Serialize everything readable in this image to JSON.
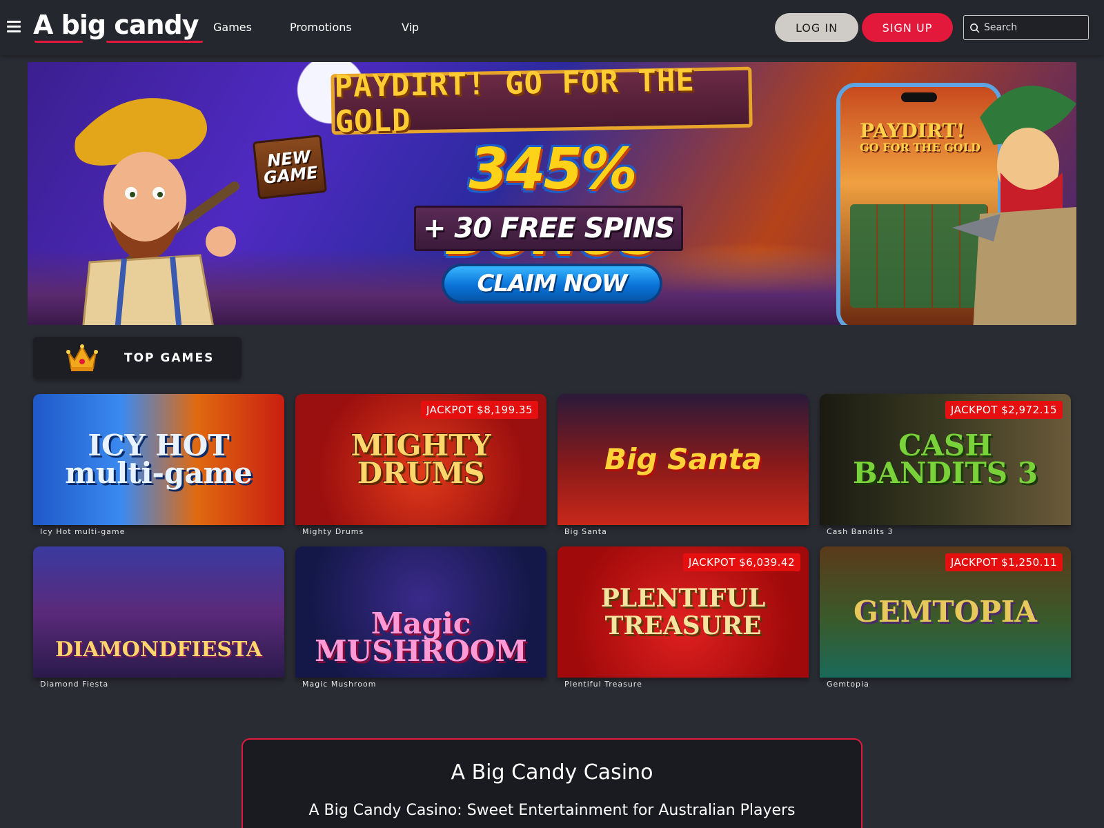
{
  "header": {
    "logo": "A big candy",
    "nav": [
      "Games",
      "Promotions",
      "Vip"
    ],
    "login_label": "LOG IN",
    "signup_label": "SIGN UP",
    "search_placeholder": "Search"
  },
  "banner": {
    "title": "PAYDIRT! GO FOR THE GOLD",
    "new_game_line1": "NEW",
    "new_game_line2": "GAME",
    "bonus": "345% BONUS",
    "spins": "+ 30 FREE SPINS",
    "cta": "CLAIM NOW",
    "phone_title_line1": "PAYDIRT!",
    "phone_title_line2": "GO FOR THE GOLD"
  },
  "top_games": {
    "title": "TOP GAMES",
    "games": [
      {
        "name": "Icy Hot multi-game",
        "logo": "ICY HOT multi-game",
        "jackpot": ""
      },
      {
        "name": "Mighty Drums",
        "logo": "MIGHTY DRUMS",
        "jackpot": "JACKPOT $8,199.35"
      },
      {
        "name": "Big Santa",
        "logo": "Big Santa",
        "jackpot": ""
      },
      {
        "name": "Cash Bandits 3",
        "logo": "CASH BANDITS 3",
        "jackpot": "JACKPOT $2,972.15"
      },
      {
        "name": "Diamond Fiesta",
        "logo": "DIAMONDFIESTA",
        "jackpot": ""
      },
      {
        "name": "Magic Mushroom",
        "logo": "Magic MUSHROOM",
        "jackpot": ""
      },
      {
        "name": "Plentiful Treasure",
        "logo": "PLENTIFUL TREASURE",
        "jackpot": "JACKPOT $6,039.42"
      },
      {
        "name": "Gemtopia",
        "logo": "GEMTOPIA",
        "jackpot": "JACKPOT $1,250.11"
      }
    ]
  },
  "info": {
    "title": "A Big Candy Casino",
    "subtitle": "A Big Candy Casino: Sweet Entertainment for Australian Players"
  },
  "colors": {
    "background": "#2a2c33",
    "header": "#25272e",
    "accent_red": "#e3193c",
    "login_bg": "#cfcbc6",
    "jackpot_red": "#e60f0f"
  },
  "icons": [
    "hamburger-menu-icon",
    "search-icon",
    "crown-icon"
  ]
}
